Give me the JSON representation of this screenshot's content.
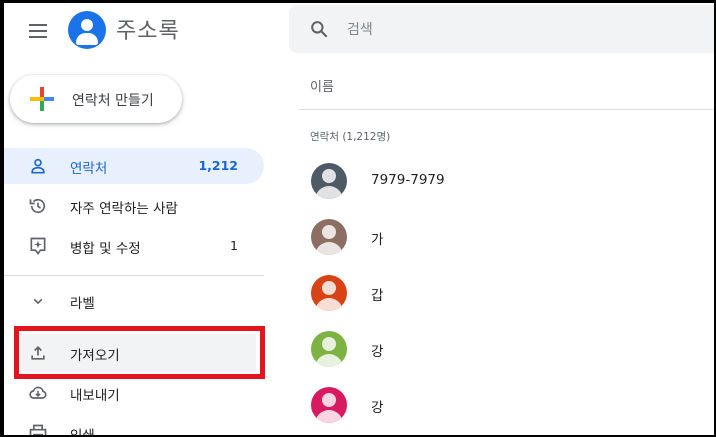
{
  "header": {
    "app_title": "주소록",
    "menu_icon": "hamburger-menu-icon",
    "logo_icon": "contacts-person-icon"
  },
  "search": {
    "placeholder": "검색",
    "value": ""
  },
  "create_button": {
    "label": "연락처 만들기",
    "icon": "multicolor-plus-icon"
  },
  "sidebar": {
    "items": [
      {
        "id": "contacts",
        "label": "연락처",
        "count": "1,212",
        "icon": "person-icon",
        "active": true
      },
      {
        "id": "frequent",
        "label": "자주 연락하는 사람",
        "count": "",
        "icon": "history-icon",
        "active": false
      },
      {
        "id": "merge",
        "label": "병합 및 수정",
        "count": "1",
        "icon": "sparkle-badge-icon",
        "active": false
      },
      {
        "id": "labels",
        "label": "라벨",
        "count": "",
        "icon": "chevron-down-icon",
        "active": false
      },
      {
        "id": "import",
        "label": "가져오기",
        "count": "",
        "icon": "upload-icon",
        "active": false
      },
      {
        "id": "export",
        "label": "내보내기",
        "count": "",
        "icon": "cloud-download-icon",
        "active": false
      },
      {
        "id": "print",
        "label": "인쇄",
        "count": "",
        "icon": "print-icon",
        "active": false
      }
    ]
  },
  "list": {
    "column_header": "이름",
    "section_title": "연락처 (1,212명)",
    "contacts": [
      {
        "name": "7979-7979",
        "avatar_color": "#4e5a65"
      },
      {
        "name": "가",
        "avatar_color": "#8d6e63"
      },
      {
        "name": "갑",
        "avatar_color": "#d84315"
      },
      {
        "name": "강",
        "avatar_color": "#7cb342"
      },
      {
        "name": "강",
        "avatar_color": "#d81b60"
      }
    ]
  },
  "colors": {
    "accent": "#1a73e8",
    "active_bg": "#e8f0fe",
    "highlight_border": "#e3141e"
  }
}
